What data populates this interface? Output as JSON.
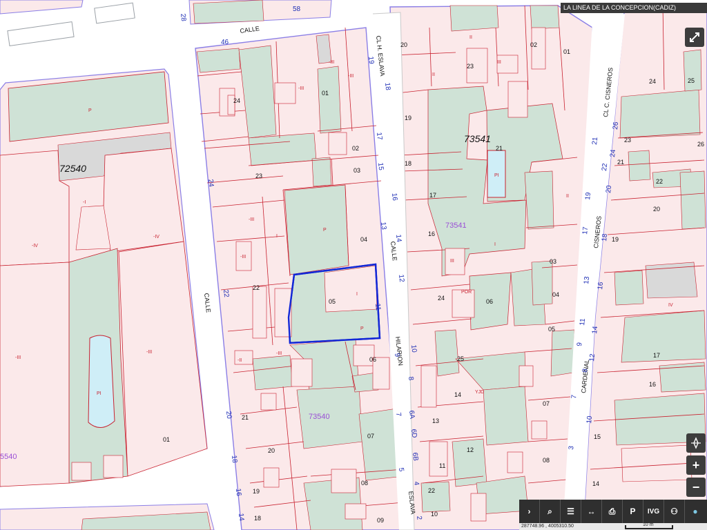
{
  "app": {
    "location_title": "LA LINEA DE LA CONCEPCION(CADIZ)"
  },
  "map": {
    "colors": {
      "built": "#fbe9ea",
      "patio": "#cfe2d6",
      "common": "#d9d9d9",
      "parcel_line": "#c8212f",
      "block_line": "#8a7ee6",
      "number_text": "#1f2fb5",
      "street_name_text": "#111111",
      "selected_parcel": "#1227d6",
      "pool": "#cfeef7",
      "block_id_purple": "#9a4fd6"
    },
    "block_ids": [
      "72540",
      "73541",
      "73541",
      "73540",
      "5540"
    ],
    "parcel_numbers": [
      "01",
      "02",
      "03",
      "04",
      "05",
      "06",
      "07",
      "08",
      "09",
      "10",
      "11",
      "12",
      "13",
      "14",
      "15",
      "16",
      "17",
      "18",
      "19",
      "20",
      "21",
      "22",
      "23",
      "24",
      "25",
      "26"
    ],
    "street_labels": [
      "CALLE",
      "CALLE",
      "CALLE",
      "CL H. ESLAVA",
      "CL C. CISNEROS",
      "HILARION",
      "ESLAVA",
      "CISNEROS",
      "CARDENAL"
    ],
    "floor_codes": [
      "I",
      "II",
      "III",
      "IV",
      "-I",
      "-II",
      "-III",
      "-IV",
      "PI",
      "P",
      "POR",
      "YJD"
    ],
    "street_numbers_left_col": [
      "28",
      "24",
      "22",
      "20",
      "18",
      "16",
      "14"
    ],
    "street_numbers_hilarion": [
      "19",
      "18",
      "17",
      "16",
      "15",
      "14",
      "13",
      "12",
      "11",
      "10",
      "9",
      "8",
      "7",
      "6",
      "5",
      "6A",
      "6B",
      "6D",
      "4",
      "2"
    ],
    "street_numbers_cisneros": [
      "21",
      "20",
      "19",
      "18",
      "17",
      "16",
      "14",
      "13",
      "12",
      "11",
      "10",
      "9",
      "8",
      "7",
      "3",
      "2",
      "22",
      "24",
      "26",
      "28"
    ],
    "street_numbers_top": [
      "46",
      "58"
    ]
  },
  "controls": {
    "fullscreen_icon": "expand-icon",
    "navigate_icon": "compass-icon",
    "zoom_in": "+",
    "zoom_out": "−"
  },
  "toolbar": {
    "items": [
      {
        "label": "›",
        "icon": "chevron-right-icon"
      },
      {
        "label": "⌕",
        "icon": "search-icon"
      },
      {
        "label": "☰",
        "icon": "layers-icon"
      },
      {
        "label": "↔",
        "icon": "measure-icon"
      },
      {
        "label": "⎙",
        "icon": "print-icon"
      },
      {
        "label": "P",
        "icon": "parking-icon"
      },
      {
        "label": "IVG",
        "icon": "ivg-icon"
      },
      {
        "label": "⚇",
        "icon": "share-icon"
      },
      {
        "label": "●",
        "icon": "info-icon"
      }
    ]
  },
  "status": {
    "coordinates": "287748.96 , 4005310.50",
    "scale_label": "10 m"
  }
}
